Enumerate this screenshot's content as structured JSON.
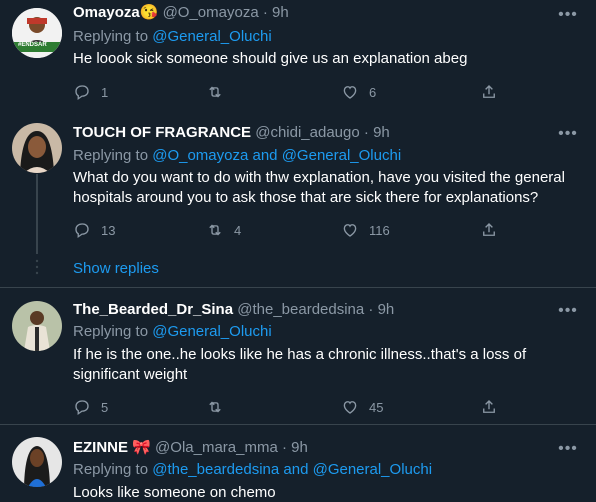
{
  "tweets": [
    {
      "name": "Omayoza",
      "name_emoji": "😘",
      "handle": "@O_omayoza",
      "time": "9h",
      "replying_prefix": "Replying to",
      "replying_targets": "@General_Oluchi",
      "replying_extra": "",
      "text": "He loook sick someone should give us an explanation abeg",
      "replies": "1",
      "retweets": "",
      "likes": "6",
      "avatar_badge": "#ENDSAR"
    },
    {
      "name": "TOUCH OF FRAGRANCE",
      "name_emoji": "",
      "handle": "@chidi_adaugo",
      "time": "9h",
      "replying_prefix": "Replying to",
      "replying_targets": "@O_omayoza",
      "replying_extra": "@General_Oluchi",
      "text": "What do you want to do with thw explanation, have you visited the general hospitals around you to ask those that are sick there for explanations?",
      "replies": "13",
      "retweets": "4",
      "likes": "116"
    },
    {
      "name": "The_Bearded_Dr_Sina",
      "name_emoji": "",
      "handle": "@the_beardedsina",
      "time": "9h",
      "replying_prefix": "Replying to",
      "replying_targets": "@General_Oluchi",
      "replying_extra": "",
      "text": "If he is the one..he looks like he has a chronic illness..that's a loss of significant weight",
      "replies": "5",
      "retweets": "",
      "likes": "45"
    },
    {
      "name": "EZINNE",
      "name_emoji": "🎀",
      "handle": "@Ola_mara_mma",
      "time": "9h",
      "replying_prefix": "Replying to",
      "replying_targets": "@the_beardedsina",
      "replying_extra": "@General_Oluchi",
      "text": "Looks like someone on chemo"
    }
  ],
  "show_replies": "Show replies",
  "and_word": "and",
  "dot": "·",
  "more_glyph": "•••",
  "colors": {
    "background": "#15202b",
    "link": "#1d9bf0",
    "muted": "#8b98a5",
    "divider": "#38444d"
  },
  "icons": [
    "reply-icon",
    "retweet-icon",
    "like-icon",
    "share-icon",
    "more-icon"
  ]
}
